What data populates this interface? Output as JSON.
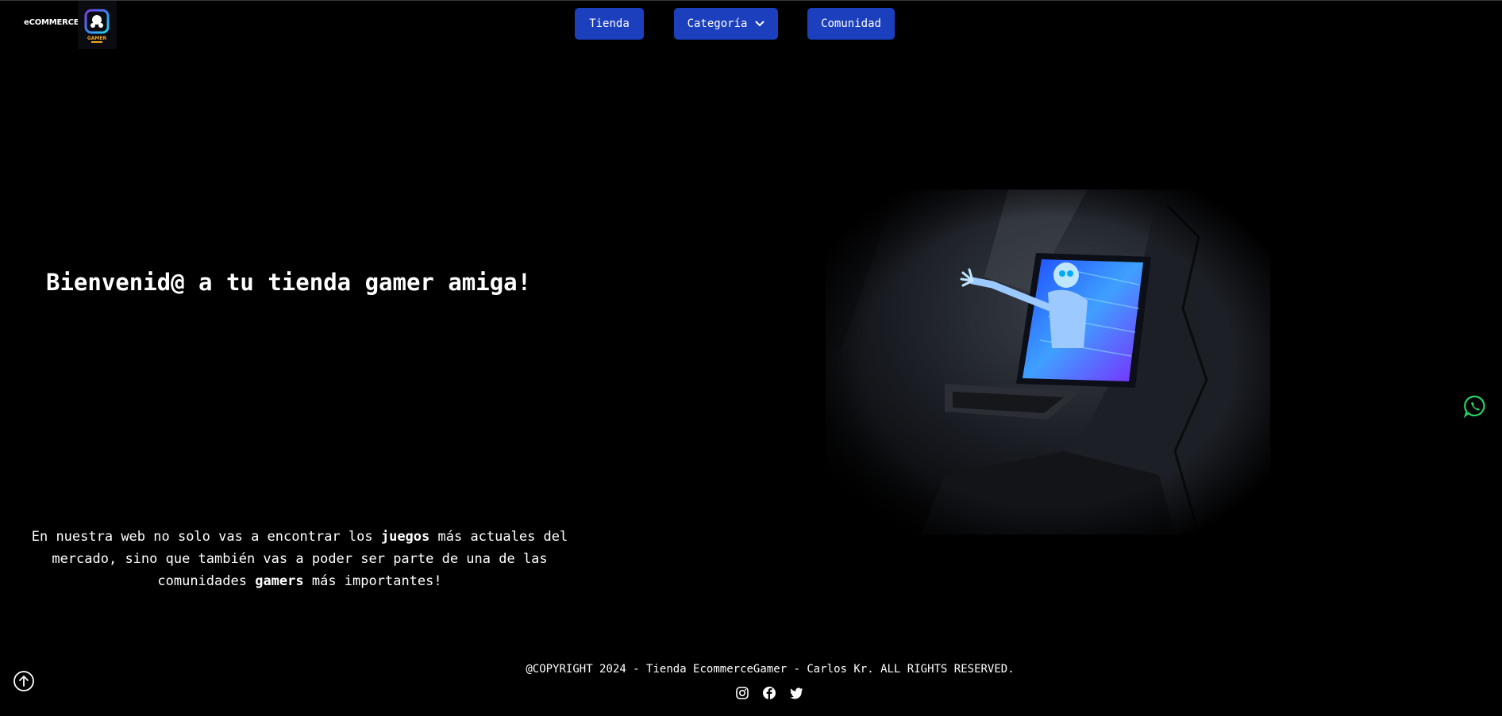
{
  "header": {
    "brand_text": "eCOMMERCE",
    "logo_icon": "gamepad-logo-icon",
    "nav": [
      {
        "label": "Tienda"
      },
      {
        "label": "Categoría",
        "icon": "chevron-down-icon"
      },
      {
        "label": "Comunidad"
      }
    ]
  },
  "hero": {
    "title": "Bienvenid@ a tu tienda gamer amiga!",
    "description": {
      "part1": "En nuestra web no solo vas a encontrar los ",
      "bold1": "juegos",
      "part2": " más actuales del mercado, sino que también vas a poder ser parte de una de las comunidades ",
      "bold2": "gamers",
      "part3": " más importantes!"
    },
    "image_icon": "robot-laptop-image"
  },
  "floating": {
    "whatsapp_icon": "whatsapp-icon",
    "back_to_top_icon": "arrow-up-circle-icon"
  },
  "footer": {
    "copyright": "@COPYRIGHT 2024 - Tienda EcommerceGamer - Carlos Kr. ALL RIGHTS RESERVED.",
    "socials": [
      "instagram-icon",
      "facebook-icon",
      "twitter-icon"
    ]
  },
  "colors": {
    "background": "#000000",
    "nav_button": "#1b3fbd",
    "whatsapp": "#25d366"
  }
}
